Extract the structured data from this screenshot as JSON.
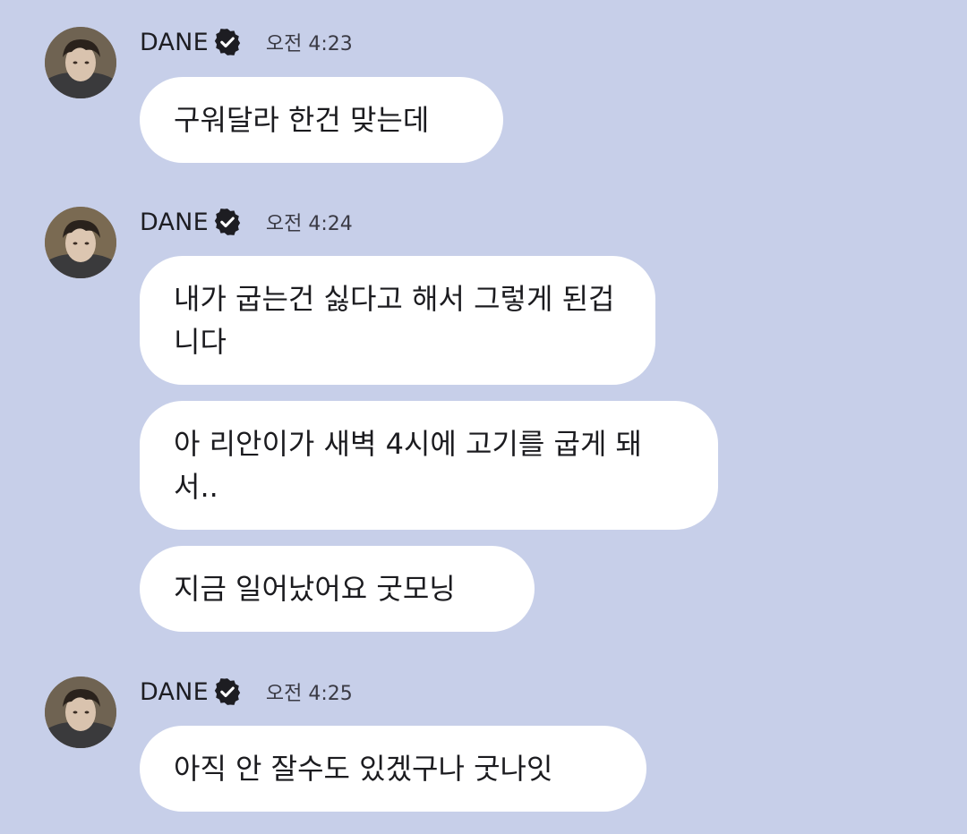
{
  "messages": [
    {
      "sender": "DANE",
      "time": "오전 4:23",
      "bubbles": [
        "구워달라 한건 맞는데"
      ]
    },
    {
      "sender": "DANE",
      "time": "오전 4:24",
      "bubbles": [
        "내가 굽는건 싫다고 해서 그렇게 된겁니다",
        "아 리안이가 새벽 4시에 고기를 굽게 돼서..",
        "지금 일어났어요 굿모닝"
      ]
    },
    {
      "sender": "DANE",
      "time": "오전 4:25",
      "bubbles": [
        "아직 안 잘수도 있겠구나 굿나잇"
      ]
    }
  ],
  "icons": {
    "avatar": "profile-photo",
    "verified": "verified-badge-icon"
  },
  "colors": {
    "background": "#c7cfe9",
    "bubble": "#ffffff",
    "badge": "#1d1d22"
  }
}
